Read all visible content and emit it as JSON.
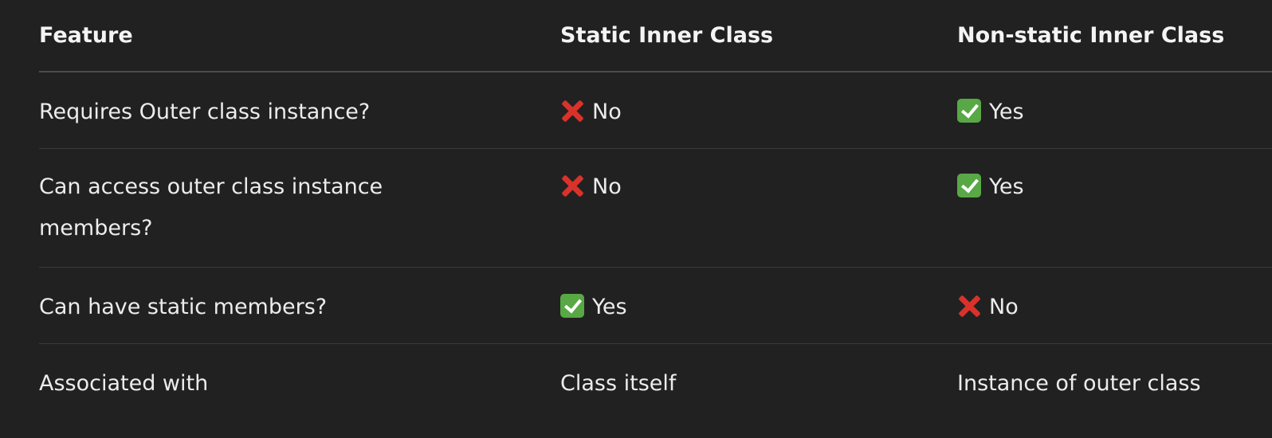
{
  "table": {
    "headers": [
      "Feature",
      "Static Inner Class",
      "Non-static Inner Class"
    ],
    "rows": [
      {
        "feature": "Requires Outer class instance?",
        "static": {
          "icon": "cross-mark-icon",
          "text": "No"
        },
        "nonstatic": {
          "icon": "check-mark-icon",
          "text": "Yes"
        }
      },
      {
        "feature": "Can access outer class instance members?",
        "static": {
          "icon": "cross-mark-icon",
          "text": "No"
        },
        "nonstatic": {
          "icon": "check-mark-icon",
          "text": "Yes"
        }
      },
      {
        "feature": "Can have static members?",
        "static": {
          "icon": "check-mark-icon",
          "text": "Yes"
        },
        "nonstatic": {
          "icon": "cross-mark-icon",
          "text": "No"
        }
      },
      {
        "feature": "Associated with",
        "static": {
          "text": "Class itself"
        },
        "nonstatic": {
          "text": "Instance of outer class"
        }
      }
    ]
  },
  "colors": {
    "background": "#212121",
    "text": "#ececec",
    "cross": "#d9322b",
    "check": "#58a845"
  }
}
